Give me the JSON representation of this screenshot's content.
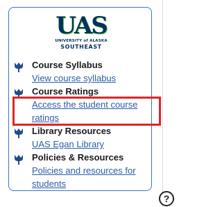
{
  "logo": {
    "letters": "UAS",
    "line1": "UNIVERSITY of ALASKA",
    "line2": "SOUTHEAST",
    "colors": {
      "navy": "#00335f",
      "green": "#7ac143"
    }
  },
  "sections": [
    {
      "icon": "tulip-icon",
      "title": "Course Syllabus",
      "link": "View course syllabus"
    },
    {
      "icon": "tulip-icon",
      "title": "Course Ratings",
      "link": "Access the student course ratings"
    },
    {
      "icon": "tulip-icon",
      "title": "Library Resources",
      "link": "UAS Egan Library"
    },
    {
      "icon": "tulip-icon",
      "title": "Policies & Resources",
      "link": "Policies and resources for students"
    }
  ],
  "help": {
    "label": "?",
    "icon": "help-circle-icon"
  },
  "colors": {
    "link": "#2a5ea8",
    "border": "#3a76c4",
    "highlight": "#e02525",
    "icon": "#1f4d8c"
  }
}
